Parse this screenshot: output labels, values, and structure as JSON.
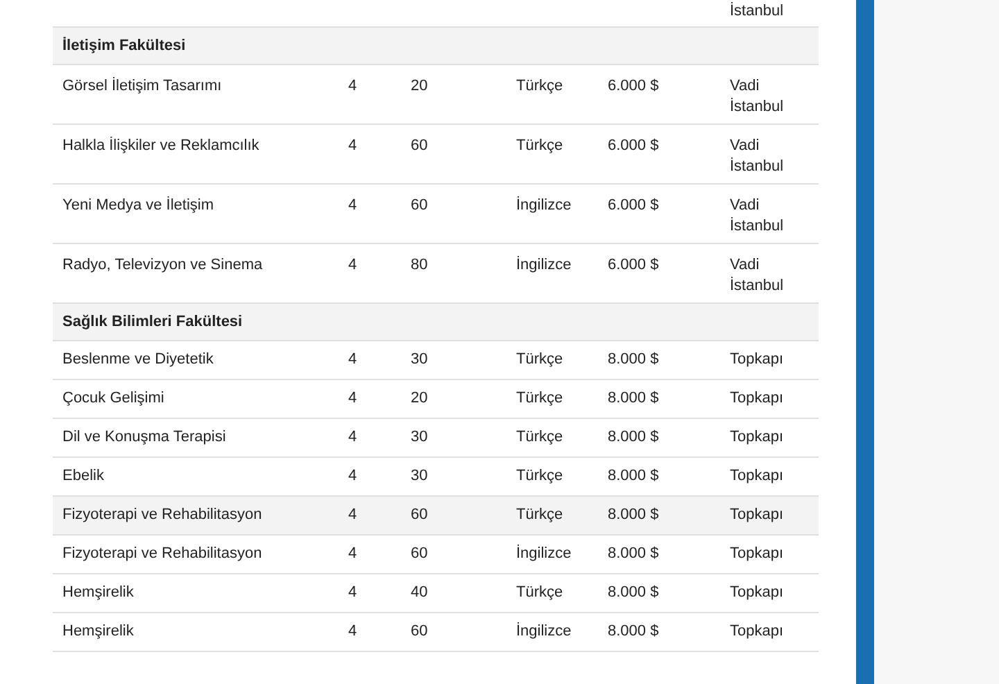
{
  "table": {
    "rows": [
      {
        "kind": "fragment",
        "campus": "İstanbul"
      },
      {
        "kind": "faculty",
        "name": "İletişim Fakültesi"
      },
      {
        "kind": "program",
        "name": "Görsel İletişim Tasarımı",
        "years": "4",
        "quota": "20",
        "language": "Türkçe",
        "fee": "6.000 $",
        "campus": "Vadi İstanbul",
        "highlighted": false
      },
      {
        "kind": "program",
        "name": "Halkla İlişkiler ve Reklamcılık",
        "years": "4",
        "quota": "60",
        "language": "Türkçe",
        "fee": "6.000 $",
        "campus": "Vadi İstanbul",
        "highlighted": false
      },
      {
        "kind": "program",
        "name": "Yeni Medya ve İletişim",
        "years": "4",
        "quota": "60",
        "language": "İngilizce",
        "fee": "6.000 $",
        "campus": "Vadi İstanbul",
        "highlighted": false
      },
      {
        "kind": "program",
        "name": "Radyo, Televizyon ve Sinema",
        "years": "4",
        "quota": "80",
        "language": "İngilizce",
        "fee": "6.000 $",
        "campus": "Vadi İstanbul",
        "highlighted": false
      },
      {
        "kind": "faculty",
        "name": "Sağlık Bilimleri Fakültesi"
      },
      {
        "kind": "program",
        "name": "Beslenme ve Diyetetik",
        "years": "4",
        "quota": "30",
        "language": "Türkçe",
        "fee": "8.000 $",
        "campus": "Topkapı",
        "highlighted": false
      },
      {
        "kind": "program",
        "name": "Çocuk Gelişimi",
        "years": "4",
        "quota": "20",
        "language": "Türkçe",
        "fee": "8.000 $",
        "campus": "Topkapı",
        "highlighted": false
      },
      {
        "kind": "program",
        "name": "Dil ve Konuşma Terapisi",
        "years": "4",
        "quota": "30",
        "language": "Türkçe",
        "fee": "8.000 $",
        "campus": "Topkapı",
        "highlighted": false
      },
      {
        "kind": "program",
        "name": "Ebelik",
        "years": "4",
        "quota": "30",
        "language": "Türkçe",
        "fee": "8.000 $",
        "campus": "Topkapı",
        "highlighted": false
      },
      {
        "kind": "program",
        "name": "Fizyoterapi ve Rehabilitasyon",
        "years": "4",
        "quota": "60",
        "language": "Türkçe",
        "fee": "8.000 $",
        "campus": "Topkapı",
        "highlighted": true
      },
      {
        "kind": "program",
        "name": "Fizyoterapi ve Rehabilitasyon",
        "years": "4",
        "quota": "60",
        "language": "İngilizce",
        "fee": "8.000 $",
        "campus": "Topkapı",
        "highlighted": false
      },
      {
        "kind": "program",
        "name": "Hemşirelik",
        "years": "4",
        "quota": "40",
        "language": "Türkçe",
        "fee": "8.000 $",
        "campus": "Topkapı",
        "highlighted": false
      },
      {
        "kind": "program",
        "name": "Hemşirelik",
        "years": "4",
        "quota": "60",
        "language": "İngilizce",
        "fee": "8.000 $",
        "campus": "Topkapı",
        "highlighted": false
      }
    ]
  }
}
